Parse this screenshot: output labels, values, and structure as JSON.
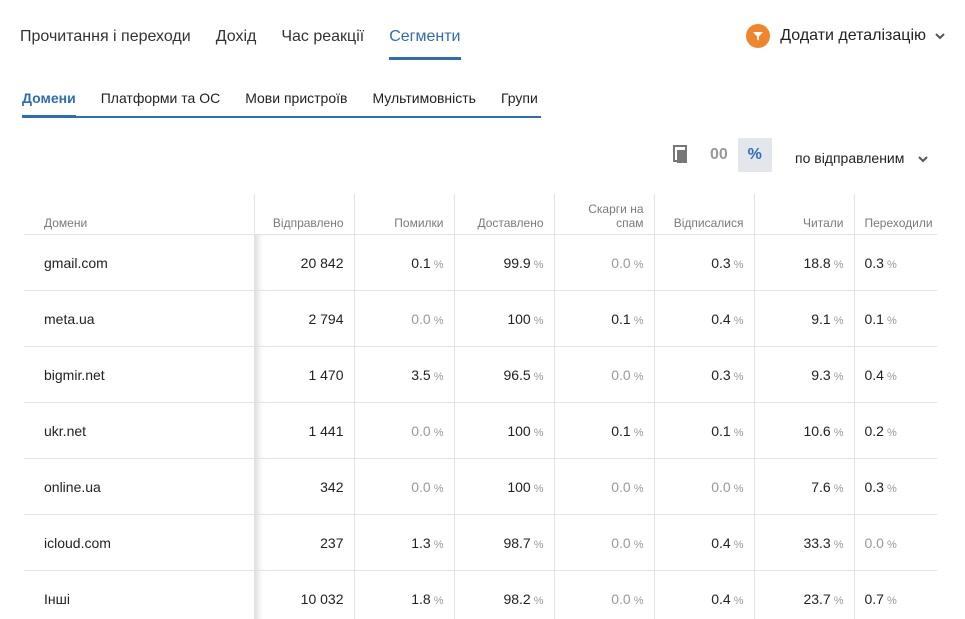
{
  "top_tabs": [
    {
      "label": "Прочитання і переходи",
      "active": false
    },
    {
      "label": "Дохід",
      "active": false
    },
    {
      "label": "Час реакції",
      "active": false
    },
    {
      "label": "Сегменти",
      "active": true
    }
  ],
  "add_detail": {
    "label": "Додати деталізацію",
    "icon": "filter-icon"
  },
  "sub_tabs": [
    {
      "label": "Домени",
      "active": true
    },
    {
      "label": "Платформи та ОС",
      "active": false
    },
    {
      "label": "Мови пристроїв",
      "active": false
    },
    {
      "label": "Мультимовність",
      "active": false
    },
    {
      "label": "Групи",
      "active": false
    }
  ],
  "toolbar": {
    "abs_label": "00",
    "pct_label": "%",
    "sort_label": "по відправленим"
  },
  "table": {
    "headers": [
      "Домени",
      "Відправлено",
      "Помилки",
      "Доставлено",
      "Скарги на спам",
      "Відписалися",
      "Читали",
      "Переходили"
    ],
    "pct_sign": "%",
    "rows": [
      {
        "domain": "gmail.com",
        "sent": "20 842",
        "values": [
          "0.1",
          "99.9",
          "0.0",
          "0.3",
          "18.8",
          "0.3"
        ]
      },
      {
        "domain": "meta.ua",
        "sent": "2 794",
        "values": [
          "0.0",
          "100",
          "0.1",
          "0.4",
          "9.1",
          "0.1"
        ]
      },
      {
        "domain": "bigmir.net",
        "sent": "1 470",
        "values": [
          "3.5",
          "96.5",
          "0.0",
          "0.3",
          "9.3",
          "0.4"
        ]
      },
      {
        "domain": "ukr.net",
        "sent": "1 441",
        "values": [
          "0.0",
          "100",
          "0.1",
          "0.1",
          "10.6",
          "0.2"
        ]
      },
      {
        "domain": "online.ua",
        "sent": "342",
        "values": [
          "0.0",
          "100",
          "0.0",
          "0.0",
          "7.6",
          "0.3"
        ]
      },
      {
        "domain": "icloud.com",
        "sent": "237",
        "values": [
          "1.3",
          "98.7",
          "0.0",
          "0.4",
          "33.3",
          "0.0"
        ]
      },
      {
        "domain": "Інші",
        "sent": "10 032",
        "values": [
          "1.8",
          "98.2",
          "0.0",
          "0.4",
          "23.7",
          "0.7"
        ]
      }
    ]
  }
}
